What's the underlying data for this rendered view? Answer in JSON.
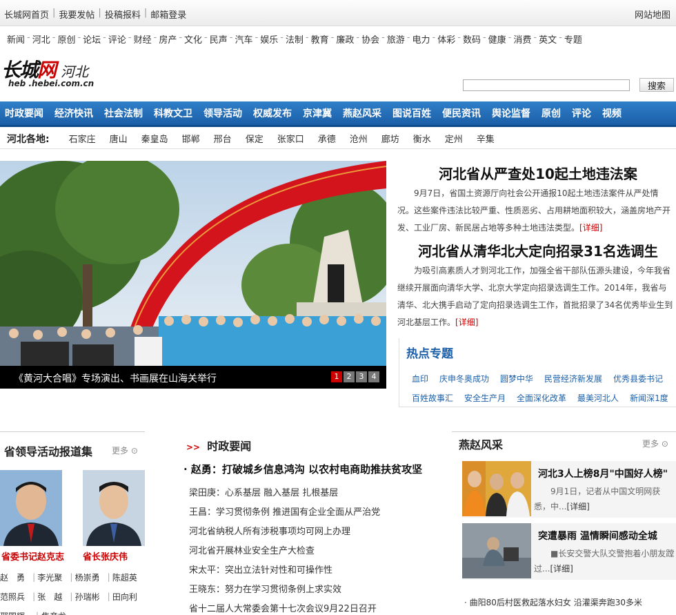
{
  "topbar": {
    "links": [
      "长城网首页",
      "我要发帖",
      "投稿报料",
      "邮箱登录"
    ],
    "sitemap": "网站地图"
  },
  "channels": [
    "新闻",
    "河北",
    "原创",
    "论坛",
    "评论",
    "财经",
    "房产",
    "文化",
    "民声",
    "汽车",
    "娱乐",
    "法制",
    "教育",
    "廉政",
    "协会",
    "旅游",
    "电力",
    "体彩",
    "数码",
    "健康",
    "消费",
    "英文",
    "专题"
  ],
  "logo": {
    "main_a": "长城",
    "main_b": "网",
    "sub": "河北",
    "url": "heb .hebei.com.cn"
  },
  "search": {
    "button": "搜索",
    "placeholder": ""
  },
  "mainnav": [
    "时政要闻",
    "经济快讯",
    "社会法制",
    "科教文卫",
    "领导活动",
    "权威发布",
    "京津冀",
    "燕赵风采",
    "图说百姓",
    "便民资讯",
    "舆论监督",
    "原创",
    "评论",
    "视频"
  ],
  "regions": {
    "label": "河北各地:",
    "items": [
      "石家庄",
      "唐山",
      "秦皇岛",
      "邯郸",
      "邢台",
      "保定",
      "张家口",
      "承德",
      "沧州",
      "廊坊",
      "衡水",
      "定州",
      "辛集"
    ]
  },
  "slide": {
    "caption": "《黄河大合唱》专场演出、书画展在山海关举行",
    "pages": [
      "1",
      "2",
      "3",
      "4"
    ],
    "active_page": 1
  },
  "headlines": [
    {
      "title": "河北省从严查处10起土地违法案",
      "summary": "9月7日，省国土资源厅向社会公开通报10起土地违法案件从严处情况。这些案件违法比较严重、性质恶劣、占用耕地面积较大，涵盖房地产开发、工业厂房、新民居占地等多种土地违法类型。",
      "more": "[详细]"
    },
    {
      "title": "河北省从清华北大定向招录31名选调生",
      "summary": "为吸引高素质人才到河北工作，加强全省干部队伍源头建设，今年我省继续开展面向清华大学、北京大学定向招录选调生工作。2014年，我省与清华、北大携手启动了定向招录选调生工作，首批招录了34名优秀毕业生到河北基层工作。",
      "more": "[详细]"
    }
  ],
  "hot_topics": {
    "title": "热点专题",
    "row1": [
      "血印",
      "庆申冬奥成功",
      "圆梦中华",
      "民营经济新发展",
      "优秀县委书记"
    ],
    "row2": [
      "百姓故事汇",
      "安全生产月",
      "全面深化改革",
      "最美河北人",
      "新闻深1度"
    ]
  },
  "leaders": {
    "title": "省领导活动报道集",
    "more": "更多",
    "photo1_name": "省委书记赵克志",
    "photo2_name": "省长张庆伟",
    "grid": [
      [
        "赵　勇",
        "李光聚",
        "杨崇勇",
        "陈超英"
      ],
      [
        "范照兵",
        "张　越",
        "孙瑞彬",
        "田向利"
      ],
      [
        "邢国辉",
        "焦彦龙",
        "",
        ""
      ]
    ]
  },
  "politics": {
    "title": "时政要闻",
    "arrow": ">>",
    "lead": "· 赵勇：打破城乡信息鸿沟 以农村电商助推扶贫攻坚",
    "items": [
      "梁田庚：心系基层 融入基层 扎根基层",
      "王昌：学习贯彻条例 推进国有企业全面从严治党",
      "河北省纳税人所有涉税事项均可网上办理",
      "河北省开展林业安全生产大检查",
      "宋太平：突出立法针对性和可操作性",
      "王晓东：努力在学习贯彻条例上求实效",
      "省十二届人大常委会第十七次会议9月22日召开"
    ]
  },
  "yanzhao": {
    "title": "燕赵风采",
    "more": "更多",
    "cards": [
      {
        "title": "河北3人上榜8月\"中国好人榜\"",
        "desc": "9月1日，记者从中国文明网获悉，中...",
        "more": "[详细]"
      },
      {
        "title": "突遭暴雨 温情瞬间感动全城",
        "desc": "■长安交警大队交警抱着小朋友蹚过...",
        "more": "[详细]"
      }
    ],
    "foot": "曲阳80后村医救起落水妇女 沿灌渠奔跑30多米"
  },
  "colors": {
    "nav_blue": "#1b5fa8",
    "accent_red": "#cc0000"
  }
}
